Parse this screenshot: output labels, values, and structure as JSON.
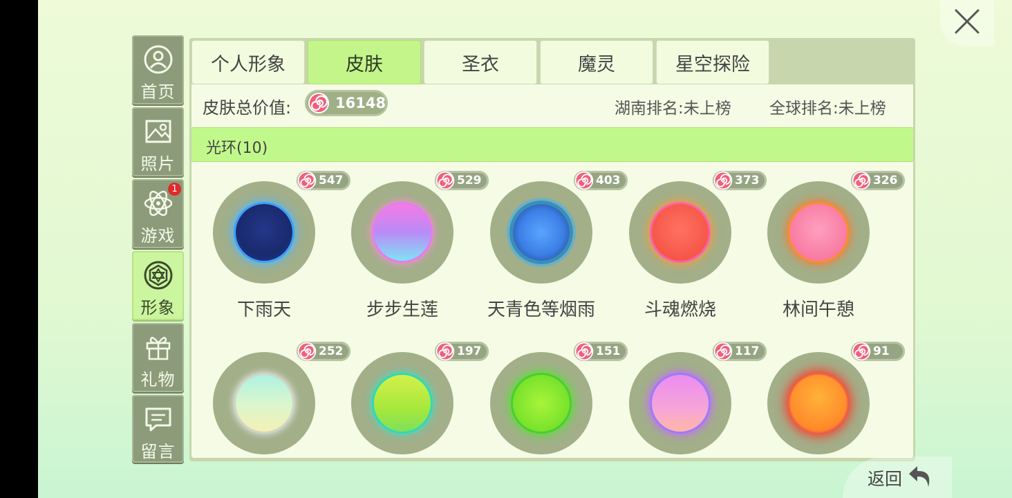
{
  "sidebar": {
    "items": [
      {
        "label": "首页",
        "icon": "profile-icon"
      },
      {
        "label": "照片",
        "icon": "photo-icon"
      },
      {
        "label": "游戏",
        "icon": "atom-icon",
        "badge": "1"
      },
      {
        "label": "形象",
        "icon": "diamond-icon"
      },
      {
        "label": "礼物",
        "icon": "gift-icon"
      },
      {
        "label": "留言",
        "icon": "message-icon"
      }
    ],
    "active": "形象"
  },
  "tabs": [
    {
      "label": "个人形象"
    },
    {
      "label": "皮肤"
    },
    {
      "label": "圣衣"
    },
    {
      "label": "魔灵"
    },
    {
      "label": "星空探险"
    }
  ],
  "active_tab": "皮肤",
  "summary": {
    "total_label": "皮肤总价值:",
    "total_value": "16148",
    "rank_local": "湖南排名:未上榜",
    "rank_global": "全球排名:未上榜"
  },
  "section": {
    "title": "光环(10)"
  },
  "items": [
    {
      "name": "下雨天",
      "price": "547"
    },
    {
      "name": "步步生莲",
      "price": "529"
    },
    {
      "name": "天青色等烟雨",
      "price": "403"
    },
    {
      "name": "斗魂燃烧",
      "price": "373"
    },
    {
      "name": "林间午憩",
      "price": "326"
    },
    {
      "name": "",
      "price": "252"
    },
    {
      "name": "",
      "price": "197"
    },
    {
      "name": "",
      "price": "151"
    },
    {
      "name": "",
      "price": "117"
    },
    {
      "name": "",
      "price": "91"
    }
  ],
  "footer": {
    "back_label": "返回"
  },
  "colors": {
    "accent_green": "#c3f58b",
    "panel": "#c7d6ad",
    "sidebar": "#8c9c7a"
  }
}
